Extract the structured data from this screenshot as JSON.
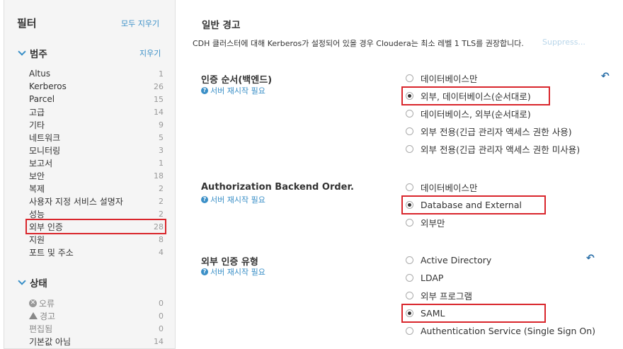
{
  "sidebar": {
    "title": "필터",
    "clear_all": "모두 지우기",
    "category": {
      "title": "범주",
      "clear": "지우기",
      "items": [
        {
          "label": "Altus",
          "count": "1"
        },
        {
          "label": "Kerberos",
          "count": "26"
        },
        {
          "label": "Parcel",
          "count": "15"
        },
        {
          "label": "고급",
          "count": "14"
        },
        {
          "label": "기타",
          "count": "9"
        },
        {
          "label": "네트워크",
          "count": "5"
        },
        {
          "label": "모니터링",
          "count": "3"
        },
        {
          "label": "보고서",
          "count": "1"
        },
        {
          "label": "보안",
          "count": "18"
        },
        {
          "label": "복제",
          "count": "2"
        },
        {
          "label": "사용자 지정 서비스 설명자",
          "count": "2"
        },
        {
          "label": "성능",
          "count": "2"
        },
        {
          "label": "외부 인증",
          "count": "28"
        },
        {
          "label": "지원",
          "count": "8"
        },
        {
          "label": "포트 및 주소",
          "count": "4"
        }
      ]
    },
    "status": {
      "title": "상태",
      "items": [
        {
          "label": "오류",
          "count": "0",
          "icon": "error-icon"
        },
        {
          "label": "경고",
          "count": "0",
          "icon": "warning-icon"
        },
        {
          "label": "편집됨",
          "count": "0"
        },
        {
          "label": "기본값 아님",
          "count": "14"
        }
      ]
    }
  },
  "main": {
    "title": "일반 경고",
    "warning": "CDH 클러스터에 대해 Kerberos가 설정되어 있을 경우 Cloudera는 최소 레벨 1 TLS를 권장합니다.",
    "suppress": "Suppress...",
    "restart_label": "서버 재시작 필요",
    "settings": [
      {
        "name": "인증 순서(백엔드)",
        "options": [
          "데이터베이스만",
          "외부, 데이터베이스(순서대로)",
          "데이터베이스, 외부(순서대로)",
          "외부 전용(긴급 관리자 액세스 권한 사용)",
          "외부 전용(긴급 관리자 액세스 권한 미사용)"
        ],
        "selected": 1
      },
      {
        "name": "Authorization Backend Order.",
        "options": [
          "데이터베이스만",
          "Database and External",
          "외부만"
        ],
        "selected": 1
      },
      {
        "name": "외부 인증 유형",
        "options": [
          "Active Directory",
          "LDAP",
          "외부 프로그램",
          "SAML",
          "Authentication Service (Single Sign On)"
        ],
        "selected": 3
      }
    ]
  },
  "colors": {
    "accent": "#3a8fc7",
    "highlight": "#d9262c"
  }
}
